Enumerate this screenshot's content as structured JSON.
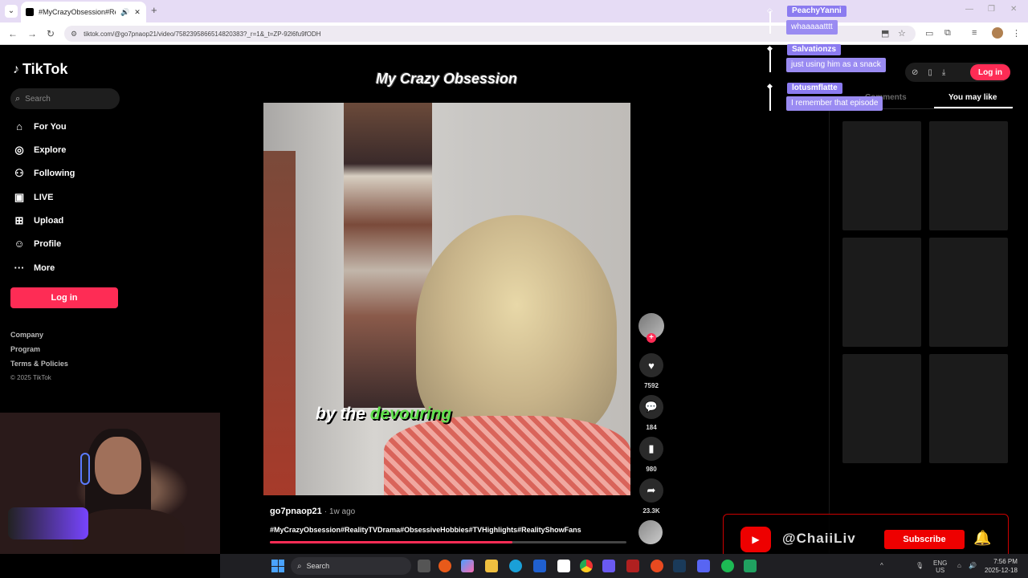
{
  "browser": {
    "tab_title": "#MyCrazyObsession#Realit",
    "url": "tiktok.com/@go7pnaop21/video/7582395866514820383?_r=1&_t=ZP-92l6fu9fODH"
  },
  "sidebar": {
    "logo": "TikTok",
    "search_placeholder": "Search",
    "nav": [
      {
        "label": "For You",
        "icon": "home-icon"
      },
      {
        "label": "Explore",
        "icon": "compass-icon"
      },
      {
        "label": "Following",
        "icon": "people-icon"
      },
      {
        "label": "LIVE",
        "icon": "live-icon"
      },
      {
        "label": "Upload",
        "icon": "plus-square-icon"
      },
      {
        "label": "Profile",
        "icon": "person-icon"
      },
      {
        "label": "More",
        "icon": "dots-icon"
      }
    ],
    "login_label": "Log in",
    "footer": [
      "Company",
      "Program",
      "Terms & Policies"
    ],
    "copyright": "© 2025 TikTok"
  },
  "video": {
    "overlay_title": "My Crazy Obsession",
    "caption_prefix": "by the",
    "caption_highlight": "devouring",
    "author": "go7pnaop21",
    "posted": "· 1w ago",
    "hashtags": "#MyCrazyObsession#RealityTVDrama#ObsessiveHobbies#TVHighlights#RealityShowFans",
    "progress": 0.68
  },
  "actions": {
    "likes": "7592",
    "comments": "184",
    "saves": "980",
    "shares": "23.3K"
  },
  "right_panel": {
    "login_label": "Log in",
    "tab_comments": "Comments",
    "tab_you_may_like": "You may like"
  },
  "chat": [
    {
      "user": "PeachyYanni",
      "message": "whaaaaatttt"
    },
    {
      "user": "Salvationzs",
      "message": "just using him as a snack"
    },
    {
      "user": "lotusmflatte",
      "message": "I remember that episode"
    }
  ],
  "stream_overlay": {
    "handle": "@ChaiiLiv",
    "subscribe_label": "Subscribe"
  },
  "taskbar": {
    "search_label": "Search",
    "lang": "ENG",
    "region": "US",
    "time": "7:56 PM",
    "date": "2025-12-18"
  },
  "colors": {
    "tiktok_pink": "#fe2c55",
    "chat_purple": "#8b7bf0",
    "youtube_red": "#ee0000",
    "caption_green": "#5ee04a"
  }
}
